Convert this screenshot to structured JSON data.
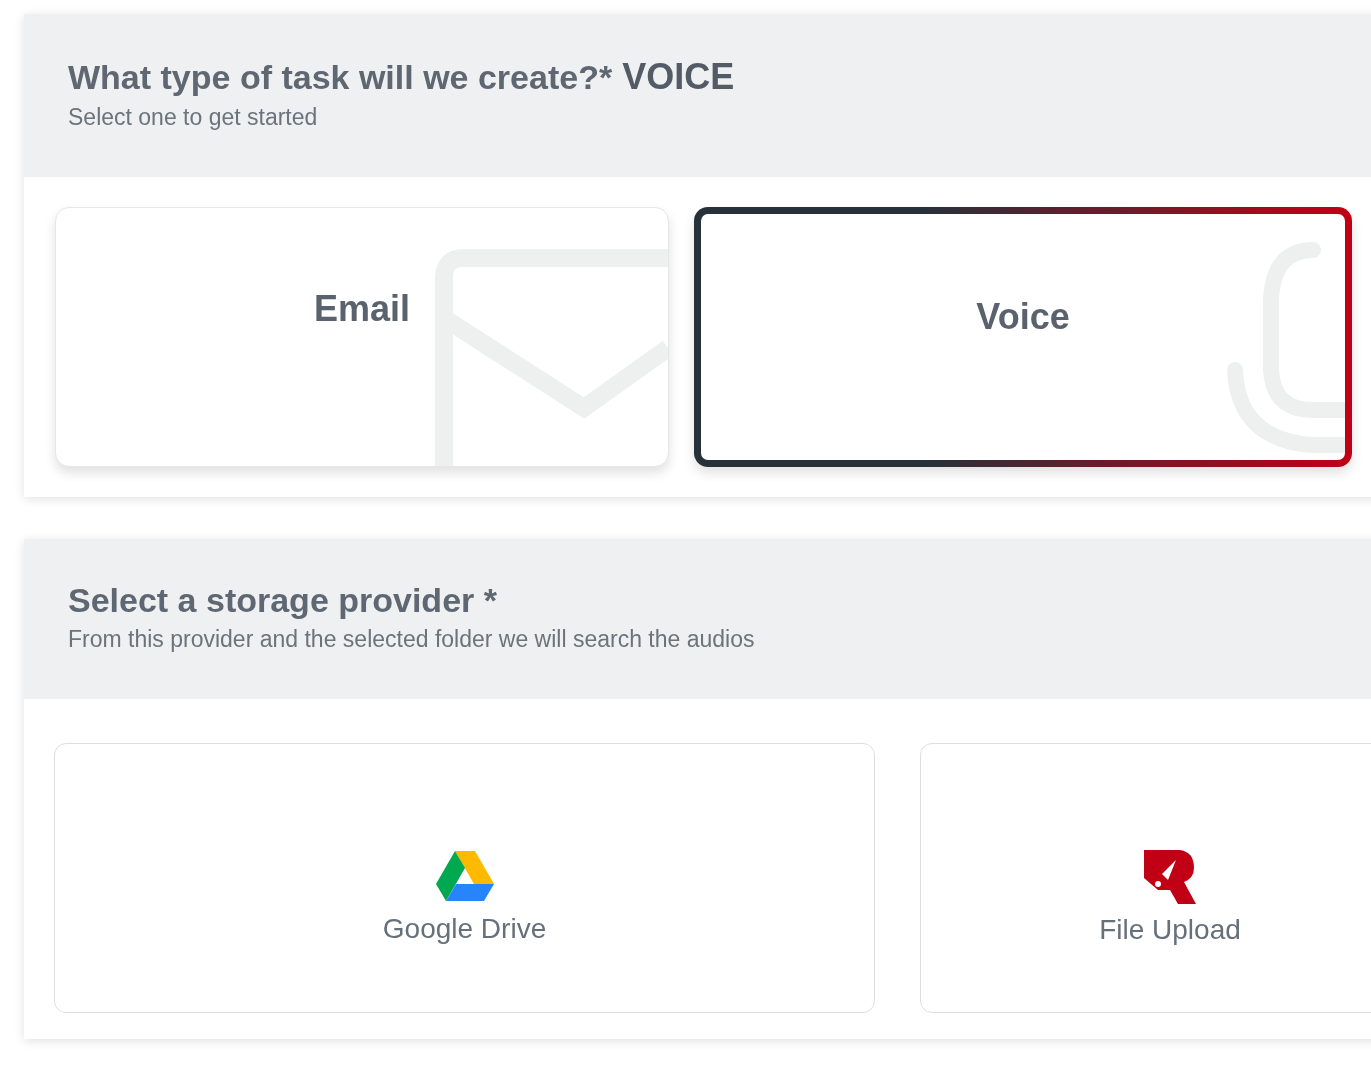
{
  "task_section": {
    "title": "What type of task will we create?*",
    "selected_value": "VOICE",
    "subtitle": "Select one to get started",
    "options": [
      {
        "kind": "email",
        "label": "Email",
        "selected": false
      },
      {
        "kind": "voice",
        "label": "Voice",
        "selected": true
      }
    ]
  },
  "storage_section": {
    "title": "Select a storage provider *",
    "subtitle": "From this provider and the selected folder we will search the audios",
    "providers": [
      {
        "kind": "drive",
        "label": "Google Drive",
        "selected": false
      },
      {
        "kind": "upload",
        "label": "File Upload",
        "selected": false
      }
    ]
  }
}
